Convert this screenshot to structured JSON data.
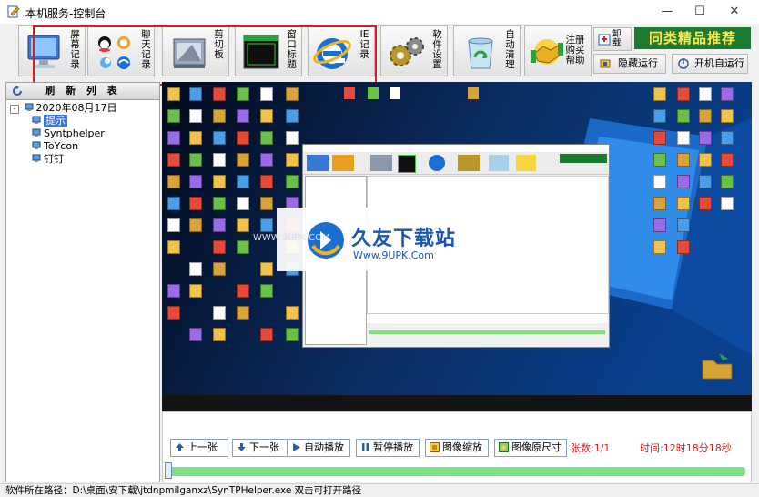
{
  "window": {
    "title": "本机服务-控制台",
    "controls": {
      "minimize": "—",
      "maximize": "☐",
      "close": "✕"
    }
  },
  "toolbar": {
    "buttons": [
      {
        "label": "屏幕记录",
        "icon": "monitor-icon"
      },
      {
        "label": "聊天记录",
        "icon": "chat-apps-icon"
      },
      {
        "label": "剪切板",
        "icon": "clipboard-icon"
      },
      {
        "label": "窗口标题",
        "icon": "window-icon"
      },
      {
        "label": "IE记录",
        "icon": "ie-icon"
      },
      {
        "label": "软件设置",
        "icon": "gears-icon"
      },
      {
        "label": "自动清理",
        "icon": "recycle-icon"
      },
      {
        "label": "注册购买帮助",
        "icon": "handshake-icon"
      }
    ],
    "uninstall_label": "卸载",
    "banner": "同类精品推荐",
    "hide_run_label": "隐藏运行",
    "autostart_label": "开机自运行"
  },
  "left_panel": {
    "refresh_label": "刷 新 列 表",
    "tree": {
      "date": "2020年08月17日",
      "items": [
        "提示",
        "Syntphelper",
        "ToYcon",
        "钉钉"
      ]
    }
  },
  "preview": {
    "watermark_brand": "久友下载站",
    "watermark_url": "Www.9UPK.Com",
    "watermark_prefix": "WWW.9UPK.COM"
  },
  "controls": {
    "prev": "上一张",
    "next": "下一张",
    "autoplay": "自动播放",
    "pause": "暂停播放",
    "scale": "图像缩放",
    "original": "图像原尺寸",
    "count": "张数:1/1",
    "time": "时间:12时18分18秒"
  },
  "colors": {
    "accent_red": "#e21a1a",
    "banner_bg": "#1c7a33",
    "banner_fg": "#ffe94a",
    "count_red": "#d4201a",
    "progress_green": "#7fe07f"
  },
  "status": {
    "text": "软件所在路径：D:\\桌面\\安下载\\jtdnpmilganxz\\SynTPHelper.exe 双击可打开路径"
  }
}
